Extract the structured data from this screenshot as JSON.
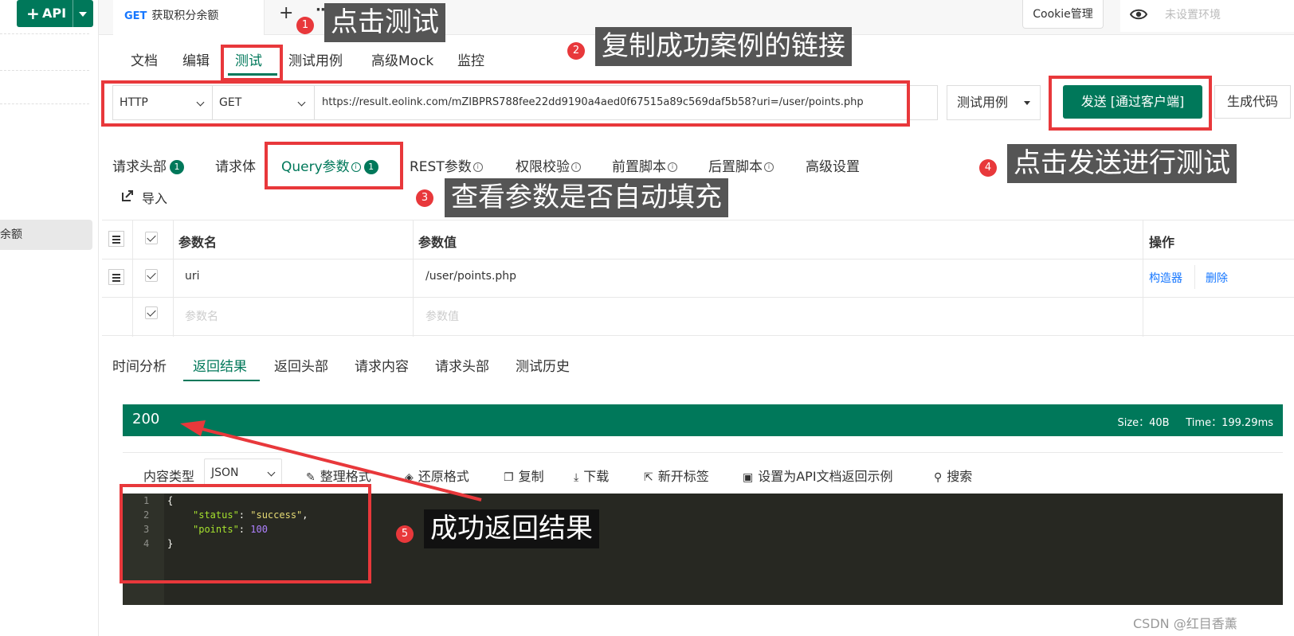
{
  "sidebar": {
    "new_api_plus": "+",
    "new_api_label": "API",
    "selected_item": "余额"
  },
  "topbar": {
    "tab_method": "GET",
    "tab_title": "获取积分余额",
    "add_tab": "+",
    "more": "···",
    "cookie_button": "Cookie管理",
    "env_label": "未设置环境"
  },
  "subtabs": [
    "文档",
    "编辑",
    "测试",
    "测试用例",
    "高级Mock",
    "监控"
  ],
  "request": {
    "protocol": "HTTP",
    "method": "GET",
    "url": "https://result.eolink.com/mZIBPRS788fee22dd9190a4aed0f67515a89c569daf5b58?uri=/user/points.php",
    "case_select": "测试用例",
    "send_button": "发送 [通过客户端]",
    "gen_code_button": "生成代码"
  },
  "param_tabs": {
    "headers": "请求头部",
    "headers_count": "1",
    "body": "请求体",
    "query": "Query参数",
    "query_count": "1",
    "rest": "REST参数",
    "auth": "权限校验",
    "pre_script": "前置脚本",
    "post_script": "后置脚本",
    "advanced": "高级设置",
    "import": "导入"
  },
  "params_table": {
    "col_name": "参数名",
    "col_value": "参数值",
    "col_actions": "操作",
    "rows": [
      {
        "name": "uri",
        "value": "/user/points.php",
        "action_builder": "构造器",
        "action_delete": "删除"
      }
    ],
    "placeholder_name": "参数名",
    "placeholder_value": "参数值"
  },
  "result_tabs": [
    "时间分析",
    "返回结果",
    "返回头部",
    "请求内容",
    "请求头部",
    "测试历史"
  ],
  "status": {
    "code": "200",
    "meta": "Size：40B     Time：199.29ms"
  },
  "toolbar": {
    "content_type_label": "内容类型",
    "content_type": "JSON",
    "format": "整理格式",
    "restore": "还原格式",
    "copy": "复制",
    "download": "下载",
    "new_tab": "新开标签",
    "set_example": "设置为API文档返回示例",
    "search": "搜索"
  },
  "response_code": {
    "line_numbers": [
      "1",
      "2",
      "3",
      "4"
    ],
    "open_brace": "{",
    "key_status": "\"status\"",
    "value_status": "\"success\"",
    "key_points": "\"points\"",
    "value_points": "100",
    "close_brace": "}"
  },
  "annotations": [
    {
      "num": "1",
      "text": "点击测试"
    },
    {
      "num": "2",
      "text": "复制成功案例的链接"
    },
    {
      "num": "3",
      "text": "查看参数是否自动填充"
    },
    {
      "num": "4",
      "text": "点击发送进行测试"
    },
    {
      "num": "5",
      "text": "成功返回结果"
    }
  ],
  "watermark": "CSDN @红目香薰",
  "colors": {
    "brand": "#00785a",
    "annotation_red": "#e8383b",
    "link_blue": "#1677ff"
  }
}
